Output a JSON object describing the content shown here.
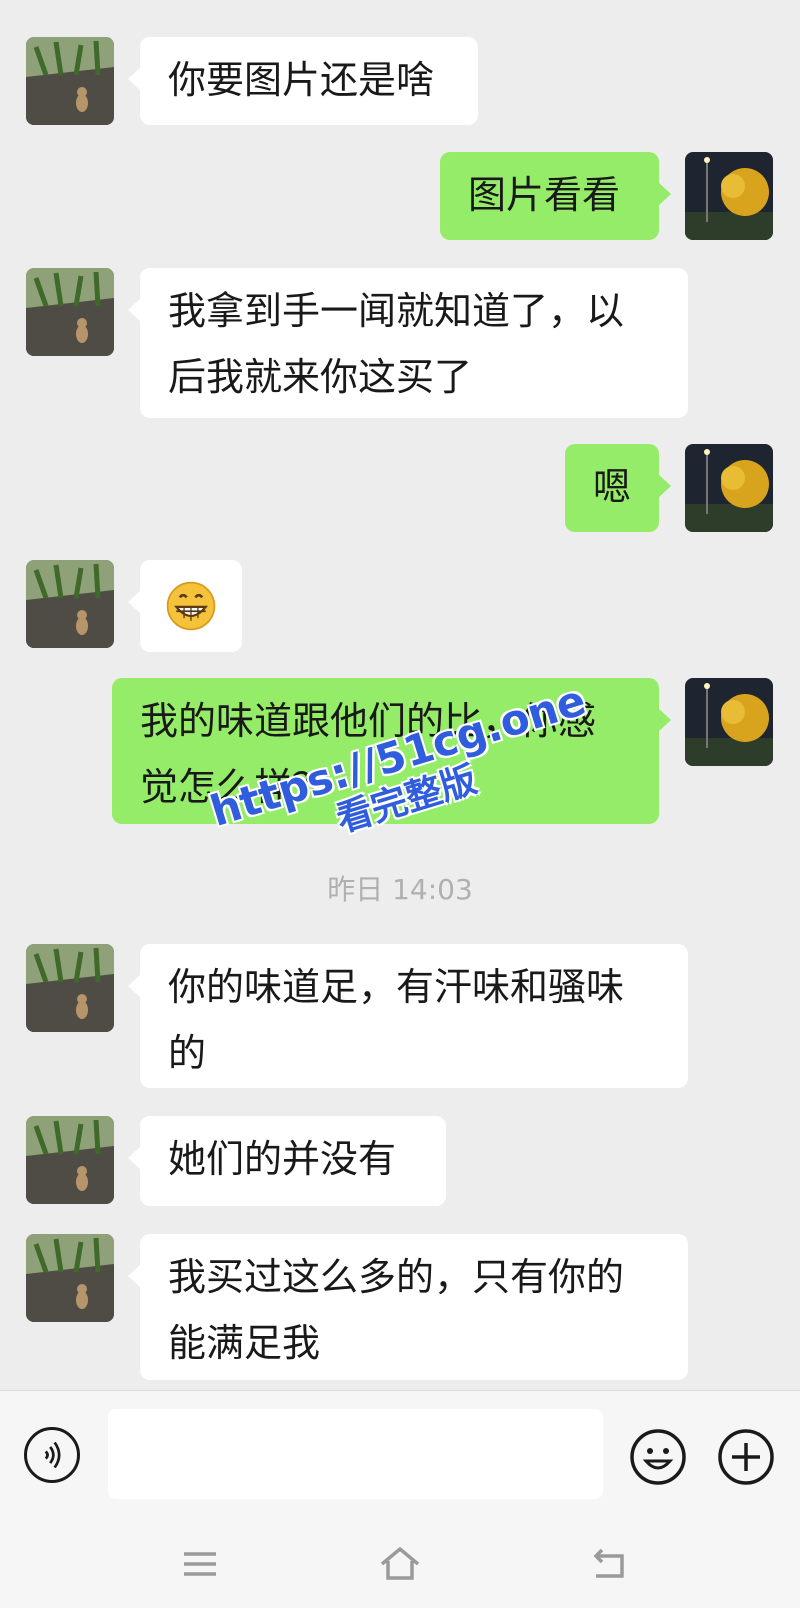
{
  "messages": [
    {
      "side": "left",
      "text": "你要图片还是啥"
    },
    {
      "side": "right",
      "text": "图片看看"
    },
    {
      "side": "left",
      "text": "我拿到手一闻就知道了，以后我就来你这买了"
    },
    {
      "side": "right",
      "text": "嗯"
    },
    {
      "side": "left",
      "emoji": "grinning-emoji"
    },
    {
      "side": "right",
      "text": "我的味道跟他们的比，你感觉怎么样？"
    },
    {
      "side": "left",
      "text": "你的味道足，有汗味和骚味的"
    },
    {
      "side": "left",
      "text": "她们的并没有"
    },
    {
      "side": "left",
      "text": "我买过这么多的，只有你的能满足我"
    }
  ],
  "timestamp": "昨日 14:03",
  "watermark": {
    "line1": "https://51cg.one",
    "line2": "看完整版"
  },
  "input": {
    "value": "",
    "placeholder": ""
  },
  "icons": {
    "voice": "voice-icon",
    "emoji": "smiley-icon",
    "plus": "plus-icon",
    "menu": "menu-icon",
    "home": "home-icon",
    "back": "back-icon"
  },
  "colors": {
    "background": "#ededed",
    "sent_bubble": "#95ec69",
    "received_bubble": "#ffffff",
    "watermark": "#2f5ddd"
  }
}
